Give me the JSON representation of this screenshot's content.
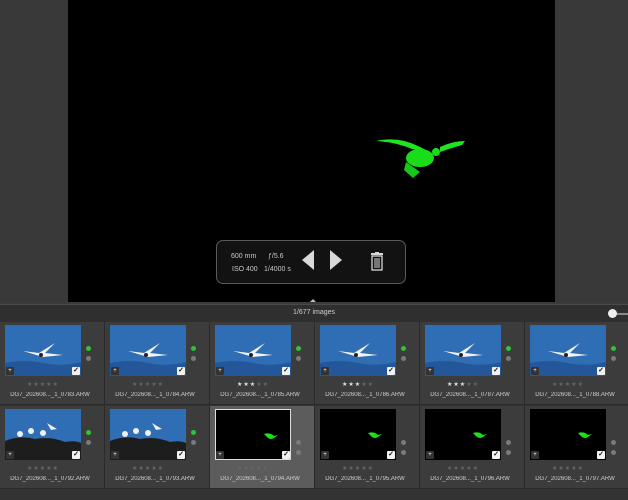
{
  "viewer": {
    "hud": {
      "focal_length": "600 mm",
      "aperture": "ƒ/5.6",
      "iso": "ISO 400",
      "shutter": "1/4000 s",
      "prev_icon": "triangle-left-icon",
      "next_icon": "triangle-right-icon",
      "trash_icon": "trash-icon"
    }
  },
  "filmstrip": {
    "count_label": "1/677 images"
  },
  "thumbnails": [
    {
      "filename": "DG7_202608..._1_0783.ARW",
      "rating": 0,
      "scene": "blue"
    },
    {
      "filename": "DG7_202608..._1_0784.ARW",
      "rating": 0,
      "scene": "blue"
    },
    {
      "filename": "DG7_202608..._1_0785.ARW",
      "rating": 3,
      "scene": "blue"
    },
    {
      "filename": "DG7_202608..._1_0786.ARW",
      "rating": 3,
      "scene": "blue"
    },
    {
      "filename": "DG7_202608..._1_0787.ARW",
      "rating": 3,
      "scene": "blue"
    },
    {
      "filename": "DG7_202608..._1_0788.ARW",
      "rating": 0,
      "scene": "blue"
    },
    {
      "filename": "DG7_202608..._1_0792.ARW",
      "rating": 0,
      "scene": "rocks"
    },
    {
      "filename": "DG7_202608..._1_0793.ARW",
      "rating": 0,
      "scene": "rocks"
    },
    {
      "filename": "DG7_202608..._1_0794.ARW",
      "rating": 0,
      "scene": "dark"
    },
    {
      "filename": "DG7_202608..._1_0795.ARW",
      "rating": 0,
      "scene": "dark"
    },
    {
      "filename": "DG7_202608..._1_0796.ARW",
      "rating": 0,
      "scene": "dark"
    },
    {
      "filename": "DG7_202608..._1_0797.ARW",
      "rating": 0,
      "scene": "dark"
    }
  ],
  "colors": {
    "accent_green": "#2ec43a",
    "highlight_green": "#19e619",
    "water_blue": "#2f6db5"
  }
}
